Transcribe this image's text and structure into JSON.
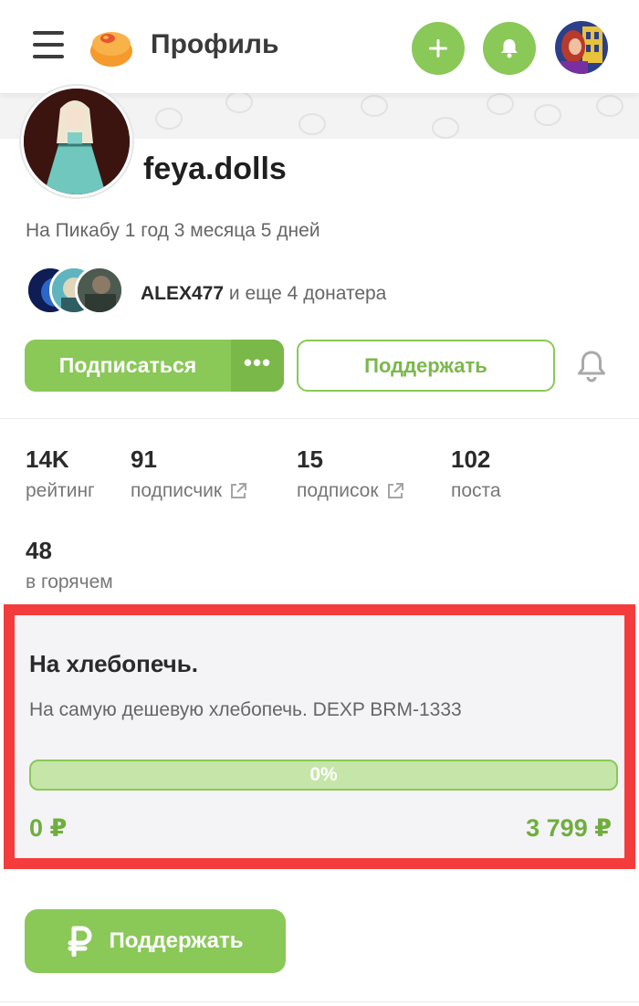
{
  "header": {
    "title": "Профиль"
  },
  "profile": {
    "username": "feya.dolls",
    "since": "На Пикабу 1 год 3 месяца 5 дней",
    "donors_name": "ALEX477",
    "donors_suffix": " и еще 4 донатера"
  },
  "actions": {
    "subscribe_label": "Подписаться",
    "more_label": "•••",
    "support_label": "Поддержать"
  },
  "stats": [
    {
      "value": "14K",
      "label": "рейтинг",
      "external": false
    },
    {
      "value": "91",
      "label": "подписчик",
      "external": true
    },
    {
      "value": "15",
      "label": "подписок",
      "external": true
    },
    {
      "value": "102",
      "label": "поста",
      "external": false
    },
    {
      "value": "48",
      "label": "в горячем",
      "external": false
    }
  ],
  "fundraiser": {
    "title": "На хлебопечь.",
    "description": "На самую дешевую хлебопечь. DEXP BRM-1333",
    "progress_label": "0%",
    "progress_fraction": 0,
    "collected": "0 ₽",
    "goal": "3 799 ₽"
  },
  "donate": {
    "icon": "ruble-icon",
    "label": "Поддержать"
  },
  "colors": {
    "accent": "#8ac858",
    "highlight_border": "#f43c3c"
  }
}
